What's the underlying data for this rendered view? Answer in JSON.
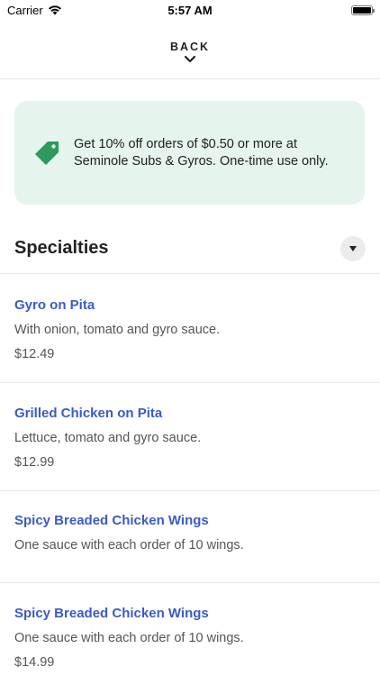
{
  "status_bar": {
    "carrier": "Carrier",
    "time": "5:57 AM"
  },
  "header": {
    "back_label": "BACK"
  },
  "promo": {
    "text": "Get 10% off orders of $0.50 or more at Seminole Subs & Gyros. One-time use only.",
    "icon": "tag-icon",
    "color": "#2e9a5b",
    "background": "#e6f4ee"
  },
  "section": {
    "title": "Specialties"
  },
  "items": [
    {
      "name": "Gyro on Pita",
      "description": "With onion, tomato and gyro sauce.",
      "price": "$12.49"
    },
    {
      "name": "Grilled Chicken on Pita",
      "description": "Lettuce, tomato and gyro sauce.",
      "price": "$12.99"
    },
    {
      "name": "Spicy Breaded Chicken Wings",
      "description": "One sauce with each order of 10 wings.",
      "price": ""
    },
    {
      "name": "Spicy Breaded Chicken Wings",
      "description": "One sauce with each order of 10 wings.",
      "price": "$14.99"
    }
  ],
  "colors": {
    "link": "#3b5bc5",
    "text": "#222222",
    "muted": "#555555"
  }
}
